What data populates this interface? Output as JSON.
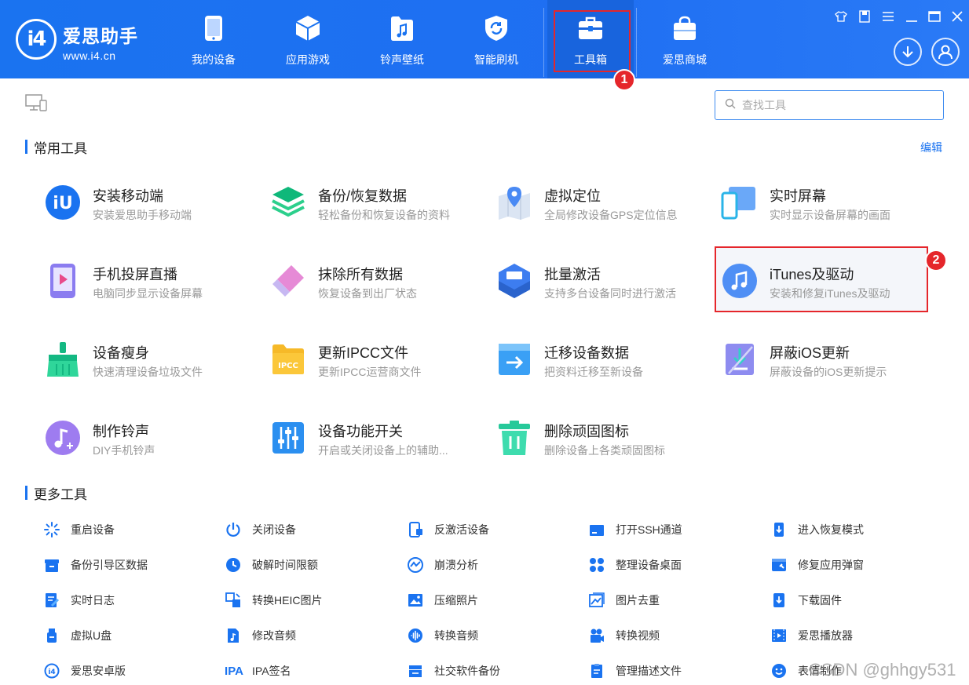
{
  "brand": {
    "logo_text": "i4",
    "name": "爱思助手",
    "url": "www.i4.cn"
  },
  "nav": [
    {
      "label": "我的设备",
      "icon": "phone-icon"
    },
    {
      "label": "应用游戏",
      "icon": "cube-icon"
    },
    {
      "label": "铃声壁纸",
      "icon": "music-folder-icon"
    },
    {
      "label": "智能刷机",
      "icon": "shield-refresh-icon"
    },
    {
      "label": "工具箱",
      "icon": "toolbox-icon",
      "active": true
    },
    {
      "label": "爱思商城",
      "icon": "shopping-bag-icon"
    }
  ],
  "badges": {
    "first": "1",
    "second": "2"
  },
  "search": {
    "placeholder": "查找工具"
  },
  "common": {
    "title": "常用工具",
    "edit": "编辑",
    "tools": [
      {
        "name": "安装移动端",
        "desc": "安装爱思助手移动端",
        "icon": "i4-logo-icon"
      },
      {
        "name": "备份/恢复数据",
        "desc": "轻松备份和恢复设备的资料",
        "icon": "layers-icon"
      },
      {
        "name": "虚拟定位",
        "desc": "全局修改设备GPS定位信息",
        "icon": "map-pin-icon"
      },
      {
        "name": "实时屏幕",
        "desc": "实时显示设备屏幕的画面",
        "icon": "screen-mirror-icon"
      },
      {
        "name": "手机投屏直播",
        "desc": "电脑同步显示设备屏幕",
        "icon": "phone-play-icon"
      },
      {
        "name": "抹除所有数据",
        "desc": "恢复设备到出厂状态",
        "icon": "eraser-icon"
      },
      {
        "name": "批量激活",
        "desc": "支持多台设备同时进行激活",
        "icon": "hexagon-box-icon"
      },
      {
        "name": "iTunes及驱动",
        "desc": "安装和修复iTunes及驱动",
        "icon": "itunes-icon"
      },
      {
        "name": "设备瘦身",
        "desc": "快速清理设备垃圾文件",
        "icon": "broom-icon"
      },
      {
        "name": "更新IPCC文件",
        "desc": "更新IPCC运营商文件",
        "icon": "ipcc-folder-icon",
        "icon_text": "IPCC"
      },
      {
        "name": "迁移设备数据",
        "desc": "把资料迁移至新设备",
        "icon": "migrate-icon"
      },
      {
        "name": "屏蔽iOS更新",
        "desc": "屏蔽设备的iOS更新提示",
        "icon": "block-update-icon"
      },
      {
        "name": "制作铃声",
        "desc": "DIY手机铃声",
        "icon": "ringtone-icon"
      },
      {
        "name": "设备功能开关",
        "desc": "开启或关闭设备上的辅助...",
        "icon": "sliders-icon"
      },
      {
        "name": "删除顽固图标",
        "desc": "删除设备上各类顽固图标",
        "icon": "trash-icon"
      }
    ]
  },
  "more": {
    "title": "更多工具",
    "tools": [
      {
        "label": "重启设备",
        "icon": "restart-icon"
      },
      {
        "label": "关闭设备",
        "icon": "power-icon"
      },
      {
        "label": "反激活设备",
        "icon": "deactivate-icon"
      },
      {
        "label": "打开SSH通道",
        "icon": "ssh-icon"
      },
      {
        "label": "进入恢复模式",
        "icon": "recovery-icon"
      },
      {
        "label": "备份引导区数据",
        "icon": "backup-boot-icon"
      },
      {
        "label": "破解时间限额",
        "icon": "clock-icon"
      },
      {
        "label": "崩溃分析",
        "icon": "crash-analysis-icon"
      },
      {
        "label": "整理设备桌面",
        "icon": "desktop-grid-icon"
      },
      {
        "label": "修复应用弹窗",
        "icon": "repair-popup-icon"
      },
      {
        "label": "实时日志",
        "icon": "log-icon"
      },
      {
        "label": "转换HEIC图片",
        "icon": "heic-convert-icon"
      },
      {
        "label": "压缩照片",
        "icon": "photo-compress-icon"
      },
      {
        "label": "图片去重",
        "icon": "photo-dedupe-icon"
      },
      {
        "label": "下载固件",
        "icon": "download-firmware-icon"
      },
      {
        "label": "虚拟U盘",
        "icon": "usb-drive-icon"
      },
      {
        "label": "修改音频",
        "icon": "audio-edit-icon"
      },
      {
        "label": "转换音频",
        "icon": "audio-convert-icon"
      },
      {
        "label": "转换视频",
        "icon": "video-convert-icon"
      },
      {
        "label": "爱思播放器",
        "icon": "player-icon"
      },
      {
        "label": "爱思安卓版",
        "icon": "i4-android-icon",
        "icon_text": "i4"
      },
      {
        "label": "IPA签名",
        "icon": "ipa-sign-icon",
        "icon_text": "IPA"
      },
      {
        "label": "社交软件备份",
        "icon": "social-backup-icon"
      },
      {
        "label": "管理描述文件",
        "icon": "profile-icon"
      },
      {
        "label": "表情制作",
        "icon": "emoji-icon"
      }
    ]
  },
  "watermark": "CSDN @ghhgy531",
  "colors": {
    "topbar": "#1a73f0",
    "accent": "#1a73f0",
    "highlight": "#e5262b"
  }
}
